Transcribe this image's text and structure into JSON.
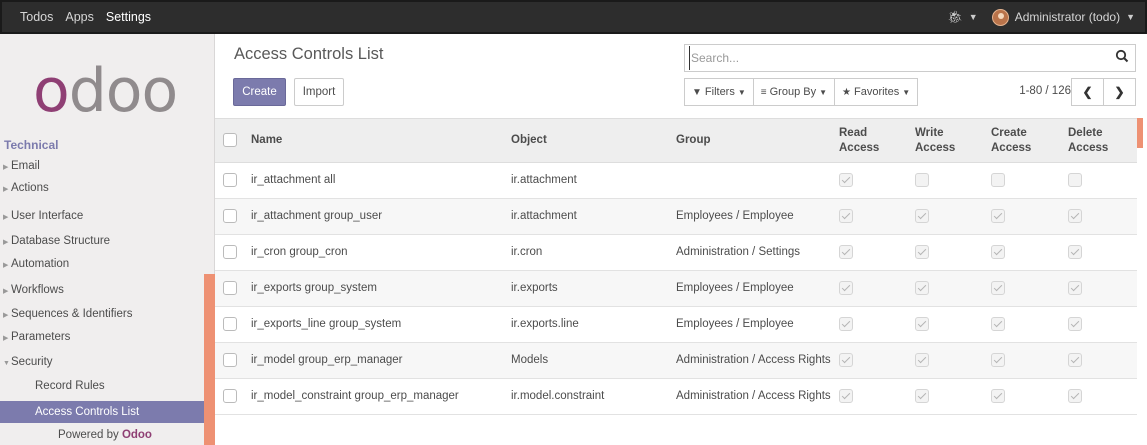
{
  "topbar": {
    "menu": [
      "Todos",
      "Apps",
      "Settings"
    ],
    "user": "Administrator (todo)"
  },
  "sidebar": {
    "logo": {
      "first": "o",
      "rest": "doo"
    },
    "section": "Technical",
    "items": [
      {
        "label": "Email"
      },
      {
        "label": "Actions"
      },
      {
        "label": "User Interface"
      },
      {
        "label": "Database Structure"
      },
      {
        "label": "Automation"
      },
      {
        "label": "Workflows"
      },
      {
        "label": "Sequences & Identifiers"
      },
      {
        "label": "Parameters"
      },
      {
        "label": "Security"
      }
    ],
    "sub_items": [
      {
        "label": "Record Rules"
      },
      {
        "label": "Access Controls List"
      }
    ],
    "powered_prefix": "Powered by",
    "powered_brand": "Odoo"
  },
  "control": {
    "title": "Access Controls List",
    "create": "Create",
    "import": "Import",
    "search_placeholder": "Search...",
    "filters": "Filters",
    "group_by": "Group By",
    "favorites": "Favorites",
    "pager": "1-80 / 126"
  },
  "table": {
    "headers": {
      "name": "Name",
      "object": "Object",
      "group": "Group",
      "read": [
        "Read",
        "Access"
      ],
      "write": [
        "Write",
        "Access"
      ],
      "create": [
        "Create",
        "Access"
      ],
      "delete": [
        "Delete",
        "Access"
      ]
    },
    "rows": [
      {
        "name": "ir_attachment all",
        "object": "ir.attachment",
        "group": "",
        "read": true,
        "write": false,
        "create": false,
        "delete": false
      },
      {
        "name": "ir_attachment group_user",
        "object": "ir.attachment",
        "group": "Employees / Employee",
        "read": true,
        "write": true,
        "create": true,
        "delete": true
      },
      {
        "name": "ir_cron group_cron",
        "object": "ir.cron",
        "group": "Administration / Settings",
        "read": true,
        "write": true,
        "create": true,
        "delete": true
      },
      {
        "name": "ir_exports group_system",
        "object": "ir.exports",
        "group": "Employees / Employee",
        "read": true,
        "write": true,
        "create": true,
        "delete": true
      },
      {
        "name": "ir_exports_line group_system",
        "object": "ir.exports.line",
        "group": "Employees / Employee",
        "read": true,
        "write": true,
        "create": true,
        "delete": true
      },
      {
        "name": "ir_model group_erp_manager",
        "object": "Models",
        "group": "Administration / Access Rights",
        "read": true,
        "write": true,
        "create": true,
        "delete": true
      },
      {
        "name": "ir_model_constraint group_erp_manager",
        "object": "ir.model.constraint",
        "group": "Administration / Access Rights",
        "read": true,
        "write": true,
        "create": true,
        "delete": true
      }
    ]
  }
}
